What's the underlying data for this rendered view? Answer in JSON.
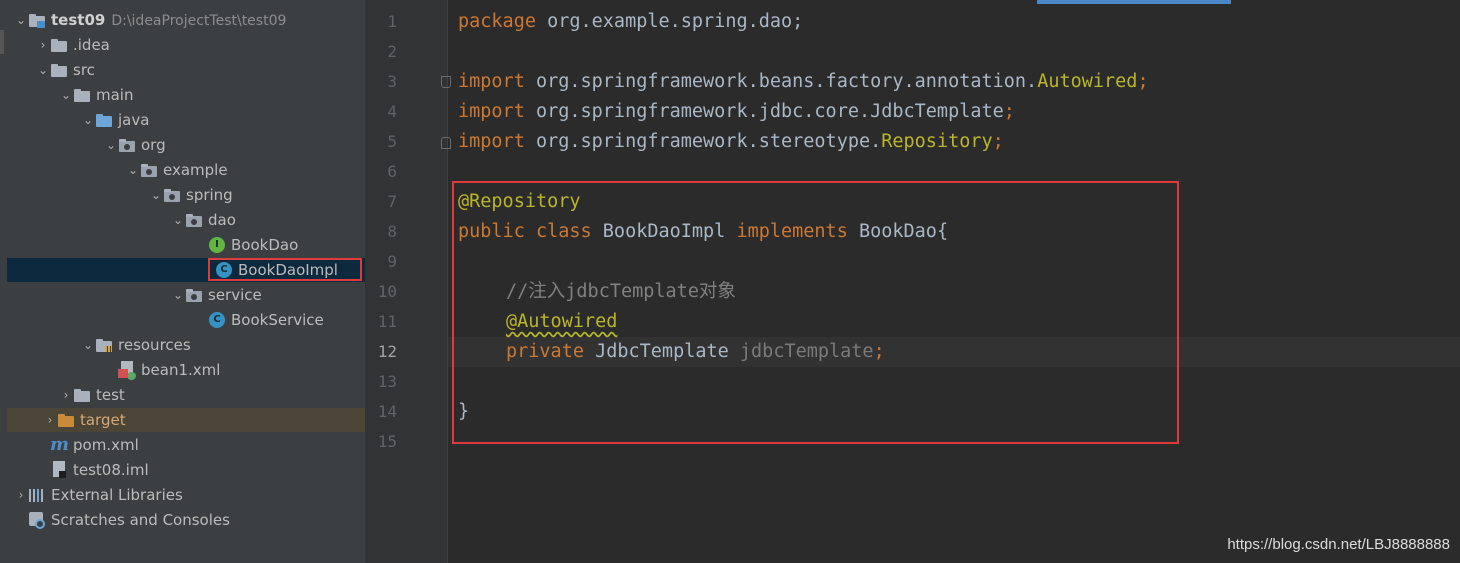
{
  "project_tree": {
    "root": {
      "name": "test09",
      "path": "D:\\ideaProjectTest\\test09"
    },
    "items": [
      {
        "label": "test09"
      },
      {
        "label": ".idea"
      },
      {
        "label": "src"
      },
      {
        "label": "main"
      },
      {
        "label": "java"
      },
      {
        "label": "org"
      },
      {
        "label": "example"
      },
      {
        "label": "spring"
      },
      {
        "label": "dao"
      },
      {
        "label": "BookDao"
      },
      {
        "label": "BookDaoImpl"
      },
      {
        "label": "service"
      },
      {
        "label": "BookService"
      },
      {
        "label": "resources"
      },
      {
        "label": "bean1.xml"
      },
      {
        "label": "test"
      },
      {
        "label": "target"
      },
      {
        "label": "pom.xml"
      },
      {
        "label": "test08.iml"
      },
      {
        "label": "External Libraries"
      },
      {
        "label": "Scratches and Consoles"
      }
    ],
    "selected_item": "BookDaoImpl"
  },
  "editor": {
    "file": "BookDaoImpl",
    "current_line": 12,
    "line_numbers": [
      "1",
      "2",
      "3",
      "4",
      "5",
      "6",
      "7",
      "8",
      "9",
      "10",
      "11",
      "12",
      "13",
      "14",
      "15"
    ],
    "lines": {
      "l1_kw": "package",
      "l1_rest": " org.example.spring.dao;",
      "l3_kw": "import",
      "l3_pkg": " org.springframework.beans.factory.annotation.",
      "l3_cls": "Autowired",
      "l3_semi": ";",
      "l4_kw": "import",
      "l4_rest": " org.springframework.jdbc.core.JdbcTemplate",
      "l4_semi": ";",
      "l5_kw": "import",
      "l5_pkg": " org.springframework.stereotype.",
      "l5_cls": "Repository",
      "l5_semi": ";",
      "l7_ann": "@Repository",
      "l8_kw1": "public class",
      "l8_name": " BookDaoImpl ",
      "l8_kw2": "implements",
      "l8_rest": " BookDao{",
      "l10_cmt": "//注入jdbcTemplate对象",
      "l11_ann": "@Autowired",
      "l12_kw": "private",
      "l12_type": " JdbcTemplate ",
      "l12_field": "jdbcTemplate",
      "l12_semi": ";",
      "l14_brace": "}"
    }
  },
  "watermark": "https://blog.csdn.net/LBJ8888888",
  "colors": {
    "keyword": "#cc7832",
    "annotation": "#bbb529",
    "comment": "#808080",
    "highlight_box": "#e03b3b",
    "selection": "#0d293e"
  }
}
